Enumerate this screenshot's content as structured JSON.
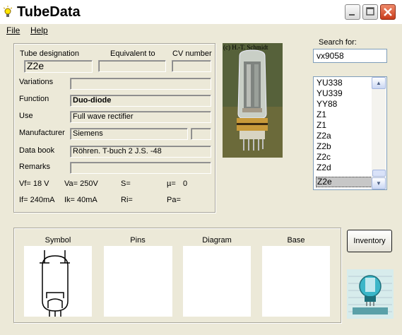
{
  "window": {
    "title": "TubeData"
  },
  "menu": {
    "file": "File",
    "help": "Help"
  },
  "details": {
    "labels": {
      "designation": "Tube designation",
      "equivalent": "Equivalent to",
      "cv": "CV number",
      "variations": "Variations",
      "function": "Function",
      "use": "Use",
      "manufacturer": "Manufacturer",
      "databook": "Data book",
      "remarks": "Remarks"
    },
    "values": {
      "designation": "Z2e",
      "equivalent": "",
      "cv": "",
      "variations": "",
      "function": "Duo-diode",
      "use": "Full wave rectifier",
      "manufacturer": "Siemens",
      "manufacturer_extra": "",
      "databook": "Röhren. T-buch 2 J.S. -48",
      "remarks": ""
    },
    "params": {
      "vf": "Vf= 18 V",
      "va": "Va= 250V",
      "s": "S=",
      "mu": "µ=",
      "mu_val": "0",
      "if": "If= 240mA",
      "ik": "Ik= 40mA",
      "ri": "Ri=",
      "pa": "Pa="
    }
  },
  "photo": {
    "credit": "(c) H.-T. Schmidt"
  },
  "search": {
    "label": "Search for:",
    "value": "vx9058"
  },
  "tube_list": {
    "items": [
      "YU338",
      "YU339",
      "YY88",
      "Z1",
      "Z1",
      "Z2a",
      "Z2b",
      "Z2c",
      "Z2d",
      "Z2e"
    ],
    "selected": "Z2e"
  },
  "lower": {
    "symbol": "Symbol",
    "pins": "Pins",
    "diagram": "Diagram",
    "base": "Base"
  },
  "inventory_button": "Inventory",
  "colors": {
    "titlebar": "#ffffff",
    "close_button": "#d24a2a",
    "window_bg": "#ece9d8",
    "selection": "#c7c7c7"
  },
  "icons": [
    "lightbulb-icon",
    "minimize-icon",
    "maximize-icon",
    "close-icon",
    "scroll-up-icon",
    "scroll-down-icon",
    "tube-symbol-icon",
    "tube-logo-icon"
  ]
}
